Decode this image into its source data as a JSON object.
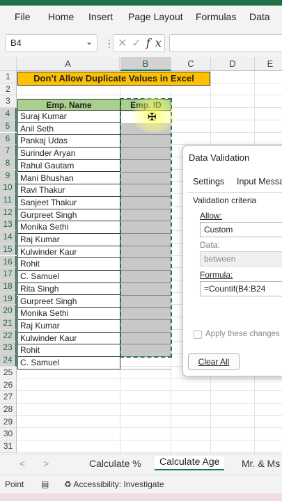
{
  "menu": [
    "File",
    "Home",
    "Insert",
    "Page Layout",
    "Formulas",
    "Data"
  ],
  "formula_bar": {
    "name_box": "B4",
    "cancel_icon": "close-icon",
    "enter_icon": "check-icon",
    "fx_label": "fx",
    "value": ""
  },
  "columns": [
    "A",
    "B",
    "C",
    "D",
    "E"
  ],
  "rows": [
    "1",
    "2",
    "3",
    "4",
    "5",
    "6",
    "7",
    "8",
    "9",
    "10",
    "11",
    "12",
    "13",
    "14",
    "15",
    "16",
    "17",
    "18",
    "19",
    "20",
    "21",
    "22",
    "23",
    "24",
    "25",
    "26",
    "27",
    "28",
    "29",
    "30",
    "31"
  ],
  "sheet": {
    "title": "Don’t Allow Duplicate Values in Excel",
    "headers": [
      "Emp. Name",
      "Emp. ID"
    ],
    "names": [
      "Suraj Kumar",
      "Anil Seth",
      "Pankaj Udas",
      "Surinder Aryan",
      "Rahul Gautam",
      "Mani Bhushan",
      "Ravi Thakur",
      "Sanjeet Thakur",
      "Gurpreet Singh",
      "Monika Sethi",
      "Raj Kumar",
      "Kulwinder Kaur",
      "Rohit",
      "C. Samuel",
      "Rita Singh",
      "Gurpreet Singh",
      "Monika Sethi",
      "Raj Kumar",
      "Kulwinder Kaur",
      "Rohit",
      "C. Samuel"
    ]
  },
  "dialog": {
    "title": "Data Validation",
    "tabs": [
      "Settings",
      "Input Messa"
    ],
    "criteria": "Validation criteria",
    "allow_label": "Allow:",
    "allow_value": "Custom",
    "data_label": "Data:",
    "data_value": "between",
    "formula_label": "Formula:",
    "formula_value": "=Countif(B4:B24",
    "apply_label": "Apply these changes",
    "clear_button": "Clear All"
  },
  "sheet_tabs": [
    "Calculate %",
    "Calculate Age",
    "Mr. & Ms"
  ],
  "active_sheet": "Calculate Age",
  "status": {
    "mode": "Point",
    "accessibility": "Accessibility: Investigate"
  },
  "colors": {
    "excel_green": "#1e7145",
    "title_fill": "#ffc000",
    "header_fill": "#a9d08e",
    "selection_fill": "#c8c8c8"
  }
}
